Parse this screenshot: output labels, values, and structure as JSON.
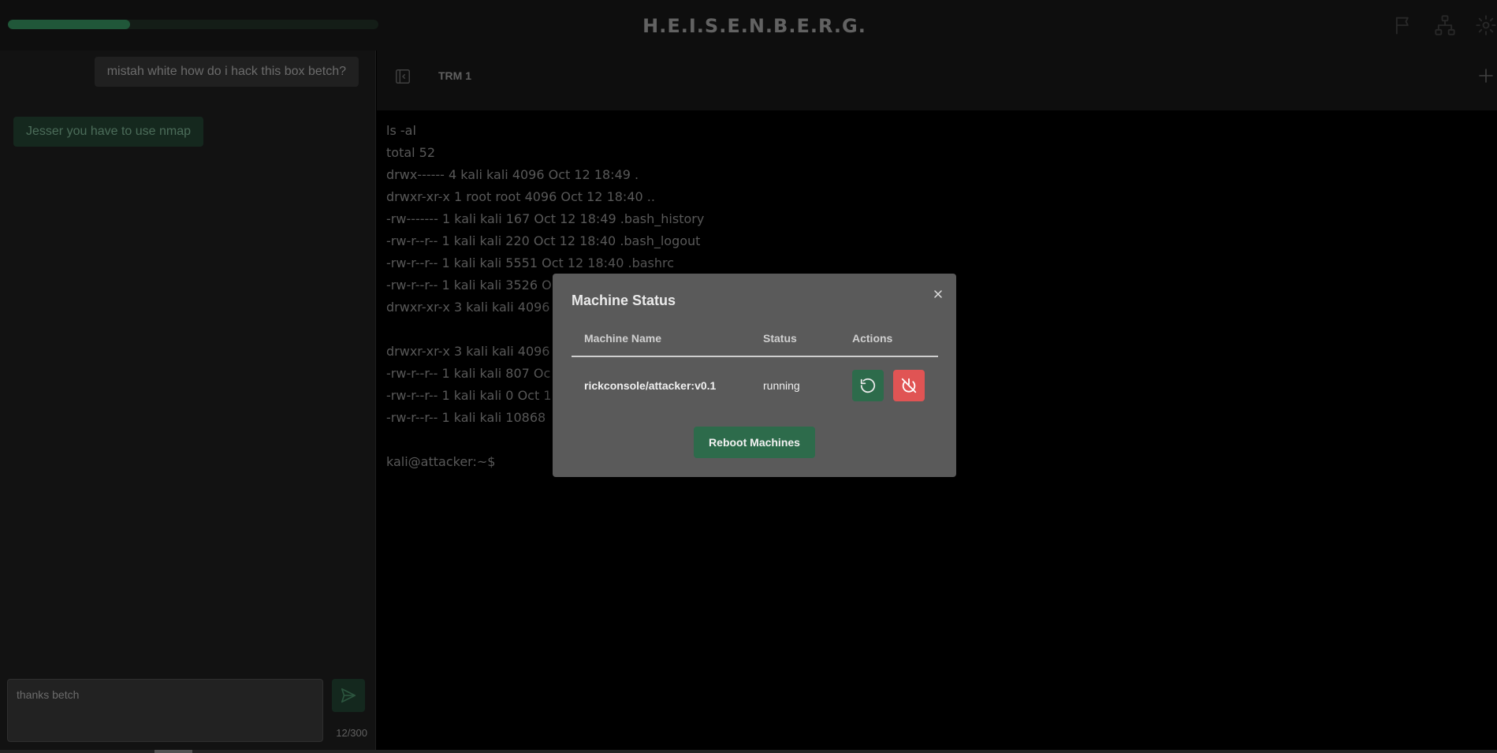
{
  "header": {
    "title": "H.E.I.S.E.N.B.E.R.G.",
    "progress_percent": 33,
    "icons": [
      "flag-icon",
      "network-icon",
      "gear-icon"
    ]
  },
  "chat": {
    "messages": [
      {
        "role": "user",
        "text": "mistah white how do i hack this box betch?"
      },
      {
        "role": "assistant",
        "text": "Jesser you have to use nmap"
      }
    ],
    "input_value": "thanks betch",
    "char_count": "12/300"
  },
  "terminal": {
    "tab_label": "TRM 1",
    "lines": [
      "ls -al",
      "total 52",
      "drwx------ 4 kali kali 4096 Oct 12 18:49 .",
      "drwxr-xr-x 1 root root 4096 Oct 12 18:40 ..",
      "-rw------- 1 kali kali 167 Oct 12 18:49 .bash_history",
      "-rw-r--r-- 1 kali kali 220 Oct 12 18:40 .bash_logout",
      "-rw-r--r-- 1 kali kali 5551 Oct 12 18:40 .bashrc",
      "-rw-r--r-- 1 kali kali 3526 O",
      "drwxr-xr-x 3 kali kali 4096 (",
      "",
      "drwxr-xr-x 3 kali kali 4096 (",
      "-rw-r--r-- 1 kali kali 807 Oc",
      "-rw-r--r-- 1 kali kali 0 Oct 1",
      "-rw-r--r-- 1 kali kali 10868",
      "",
      "kali@attacker:~$"
    ]
  },
  "modal": {
    "title": "Machine Status",
    "close_label": "×",
    "columns": [
      "Machine Name",
      "Status",
      "Actions"
    ],
    "rows": [
      {
        "name": "rickconsole/attacker:v0.1",
        "status": "running"
      }
    ],
    "reboot_label": "Reboot Machines",
    "colors": {
      "accent": "#2d6b4b",
      "danger": "#e05454"
    }
  }
}
